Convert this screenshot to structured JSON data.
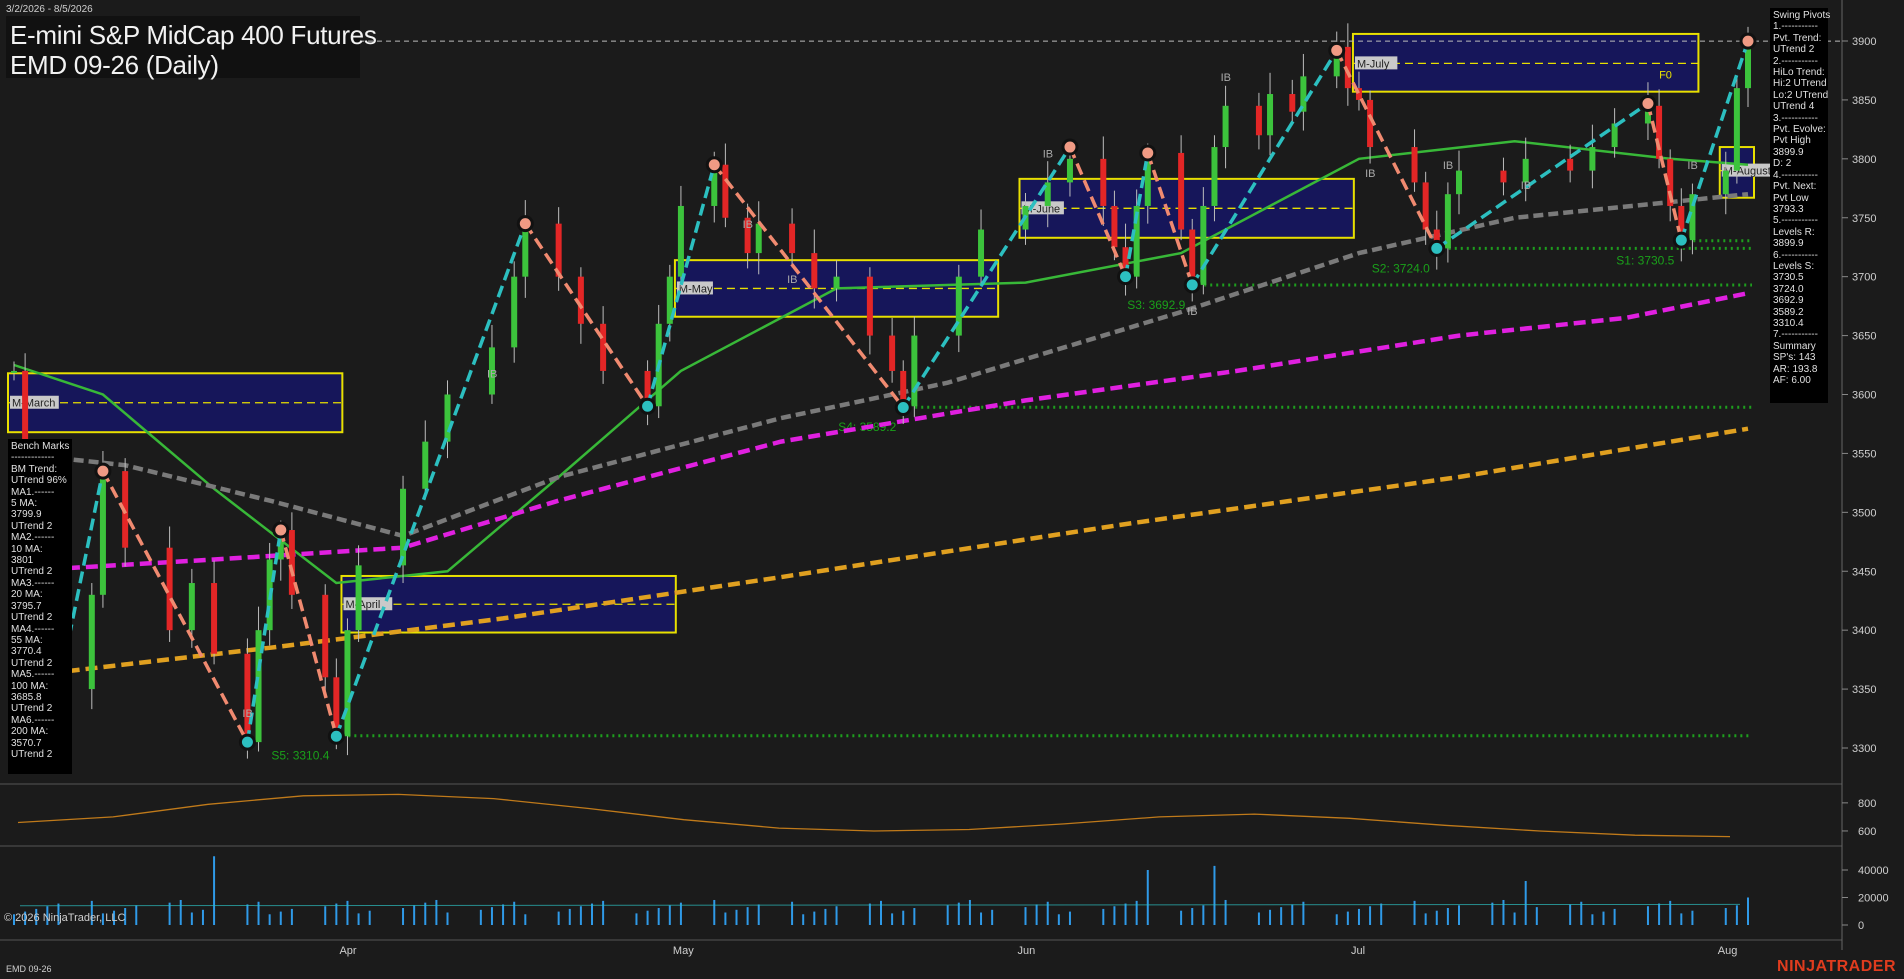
{
  "header": {
    "date_range": "3/2/2026 - 8/5/2026",
    "title": "E-mini S&P MidCap 400 Futures",
    "subtitle": "EMD 09-26 (Daily)"
  },
  "footer": {
    "copyright": "© 2026 NinjaTrader, LLC",
    "instrument": "EMD 09-26",
    "brand": "NINJATRADER"
  },
  "colors": {
    "background": "#1b1b1b",
    "up_candle": "#3cc33c",
    "down_candle": "#e32626",
    "swing_up": "#2cbfc0",
    "swing_down": "#f08a70",
    "ma_fast": "#38b838",
    "ma_slow": "#7a7a7a",
    "ma_100": "#e020e0",
    "ma_200": "#e0a020",
    "support_dotted": "#1e9e1e",
    "volume": "#2f9ae8",
    "ar_line": "#c07a1a",
    "value_box": "#16165a",
    "value_box_border": "#e8e000"
  },
  "bench_marks": {
    "lines": [
      "Bench Marks",
      "-------------",
      "BM Trend:",
      "UTrend 96%",
      "MA1.------",
      "5 MA:",
      "3799.9",
      "UTrend 2",
      "MA2.------",
      "10 MA:",
      "3801",
      "UTrend 2",
      "MA3.------",
      "20 MA:",
      "3795.7",
      "UTrend 2",
      "MA4.------",
      "55 MA:",
      "3770.4",
      "UTrend 2",
      "MA5.------",
      "100 MA:",
      "3685.8",
      "UTrend 2",
      "MA6.------",
      "200 MA:",
      "3570.7",
      "UTrend 2"
    ]
  },
  "swing_pivots": {
    "lines": [
      "Swing Pivots",
      "1.-----------",
      "Pvt. Trend:",
      "UTrend 2",
      "2.-----------",
      "HiLo Trend:",
      "Hi:2 UTrend",
      "Lo:2 UTrend",
      "UTrend 4",
      "3.-----------",
      "Pvt. Evolve:",
      "Pvt High",
      "3899.9",
      "D: 2",
      "4.-----------",
      "Pvt. Next:",
      "Pvt Low",
      "3793.3",
      "5.-----------",
      "Levels R:",
      "3899.9",
      "6.-----------",
      "Levels S:",
      "3730.5",
      "3724.0",
      "3692.9",
      "3589.2",
      "3310.4",
      "7.-----------",
      "Summary",
      "SP's: 143",
      "AR: 193.8",
      "AF: 6.00"
    ]
  },
  "chart_data": [
    {
      "type": "candlestick",
      "panel": "price",
      "x_range": [
        "2026-03-02",
        "2026-08-05"
      ],
      "ylim": [
        3270,
        3930
      ],
      "y_ticks": [
        3300,
        3350,
        3400,
        3450,
        3500,
        3550,
        3600,
        3650,
        3700,
        3750,
        3800,
        3850,
        3900
      ],
      "x_ticks": [
        {
          "label": "Apr",
          "date": "2026-04-01"
        },
        {
          "label": "May",
          "date": "2026-05-01"
        },
        {
          "label": "Jun",
          "date": "2026-06-01"
        },
        {
          "label": "Jul",
          "date": "2026-07-01"
        },
        {
          "label": "Aug",
          "date": "2026-08-03"
        }
      ],
      "close_path": [
        [
          "2026-03-02",
          3620
        ],
        [
          "2026-03-03",
          3550
        ],
        [
          "2026-03-05",
          3470
        ],
        [
          "2026-03-06",
          3350
        ],
        [
          "2026-03-09",
          3430
        ],
        [
          "2026-03-10",
          3535
        ],
        [
          "2026-03-12",
          3470
        ],
        [
          "2026-03-16",
          3400
        ],
        [
          "2026-03-18",
          3440
        ],
        [
          "2026-03-20",
          3380
        ],
        [
          "2026-03-23",
          3305
        ],
        [
          "2026-03-24",
          3400
        ],
        [
          "2026-03-25",
          3460
        ],
        [
          "2026-03-26",
          3485
        ],
        [
          "2026-03-27",
          3430
        ],
        [
          "2026-03-30",
          3360
        ],
        [
          "2026-03-31",
          3310
        ],
        [
          "2026-04-01",
          3400
        ],
        [
          "2026-04-02",
          3455
        ],
        [
          "2026-04-06",
          3520
        ],
        [
          "2026-04-08",
          3560
        ],
        [
          "2026-04-10",
          3600
        ],
        [
          "2026-04-14",
          3640
        ],
        [
          "2026-04-16",
          3700
        ],
        [
          "2026-04-17",
          3745
        ],
        [
          "2026-04-20",
          3700
        ],
        [
          "2026-04-22",
          3660
        ],
        [
          "2026-04-24",
          3620
        ],
        [
          "2026-04-28",
          3590
        ],
        [
          "2026-04-29",
          3660
        ],
        [
          "2026-04-30",
          3700
        ],
        [
          "2026-05-01",
          3760
        ],
        [
          "2026-05-04",
          3795
        ],
        [
          "2026-05-05",
          3750
        ],
        [
          "2026-05-07",
          3720
        ],
        [
          "2026-05-08",
          3745
        ],
        [
          "2026-05-11",
          3720
        ],
        [
          "2026-05-13",
          3690
        ],
        [
          "2026-05-15",
          3700
        ],
        [
          "2026-05-18",
          3650
        ],
        [
          "2026-05-20",
          3620
        ],
        [
          "2026-05-21",
          3590
        ],
        [
          "2026-05-22",
          3650
        ],
        [
          "2026-05-26",
          3700
        ],
        [
          "2026-05-28",
          3740
        ],
        [
          "2026-06-01",
          3760
        ],
        [
          "2026-06-03",
          3780
        ],
        [
          "2026-06-05",
          3800
        ],
        [
          "2026-06-08",
          3760
        ],
        [
          "2026-06-09",
          3725
        ],
        [
          "2026-06-10",
          3700
        ],
        [
          "2026-06-11",
          3760
        ],
        [
          "2026-06-12",
          3805
        ],
        [
          "2026-06-15",
          3740
        ],
        [
          "2026-06-16",
          3693
        ],
        [
          "2026-06-17",
          3760
        ],
        [
          "2026-06-18",
          3810
        ],
        [
          "2026-06-19",
          3845
        ],
        [
          "2026-06-22",
          3820
        ],
        [
          "2026-06-23",
          3855
        ],
        [
          "2026-06-25",
          3840
        ],
        [
          "2026-06-26",
          3870
        ],
        [
          "2026-06-29",
          3895
        ],
        [
          "2026-06-30",
          3860
        ],
        [
          "2026-07-01",
          3850
        ],
        [
          "2026-07-02",
          3810
        ],
        [
          "2026-07-06",
          3780
        ],
        [
          "2026-07-07",
          3740
        ],
        [
          "2026-07-08",
          3724
        ],
        [
          "2026-07-09",
          3770
        ],
        [
          "2026-07-10",
          3790
        ],
        [
          "2026-07-14",
          3780
        ],
        [
          "2026-07-16",
          3800
        ],
        [
          "2026-07-20",
          3790
        ],
        [
          "2026-07-22",
          3810
        ],
        [
          "2026-07-24",
          3830
        ],
        [
          "2026-07-27",
          3845
        ],
        [
          "2026-07-28",
          3800
        ],
        [
          "2026-07-29",
          3760
        ],
        [
          "2026-07-30",
          3731
        ],
        [
          "2026-07-31",
          3770
        ],
        [
          "2026-08-03",
          3790
        ],
        [
          "2026-08-04",
          3860
        ],
        [
          "2026-08-05",
          3895
        ]
      ],
      "moving_averages": [
        {
          "name": "20 MA",
          "color": "#38b838",
          "points": [
            [
              "2026-03-02",
              3625
            ],
            [
              "2026-03-10",
              3600
            ],
            [
              "2026-03-20",
              3520
            ],
            [
              "2026-03-31",
              3440
            ],
            [
              "2026-04-10",
              3450
            ],
            [
              "2026-04-20",
              3530
            ],
            [
              "2026-05-01",
              3620
            ],
            [
              "2026-05-15",
              3690
            ],
            [
              "2026-06-01",
              3695
            ],
            [
              "2026-06-15",
              3720
            ],
            [
              "2026-07-01",
              3800
            ],
            [
              "2026-07-15",
              3815
            ],
            [
              "2026-07-29",
              3800
            ],
            [
              "2026-08-05",
              3795
            ]
          ]
        },
        {
          "name": "55 MA",
          "color": "#7a7a7a",
          "points": [
            [
              "2026-03-02",
              3550
            ],
            [
              "2026-03-12",
              3540
            ],
            [
              "2026-03-25",
              3510
            ],
            [
              "2026-04-06",
              3480
            ],
            [
              "2026-04-20",
              3530
            ],
            [
              "2026-05-10",
              3580
            ],
            [
              "2026-05-25",
              3610
            ],
            [
              "2026-06-15",
              3670
            ],
            [
              "2026-07-01",
              3720
            ],
            [
              "2026-07-15",
              3750
            ],
            [
              "2026-08-05",
              3770
            ]
          ]
        },
        {
          "name": "100 MA",
          "color": "#e020e0",
          "points": [
            [
              "2026-03-02",
              3450
            ],
            [
              "2026-03-20",
              3460
            ],
            [
              "2026-04-06",
              3470
            ],
            [
              "2026-04-20",
              3510
            ],
            [
              "2026-05-10",
              3560
            ],
            [
              "2026-06-01",
              3595
            ],
            [
              "2026-06-20",
              3620
            ],
            [
              "2026-07-10",
              3650
            ],
            [
              "2026-07-25",
              3665
            ],
            [
              "2026-08-05",
              3686
            ]
          ]
        },
        {
          "name": "200 MA",
          "color": "#e0a020",
          "points": [
            [
              "2026-03-02",
              3360
            ],
            [
              "2026-03-25",
              3385
            ],
            [
              "2026-04-15",
              3410
            ],
            [
              "2026-05-10",
              3445
            ],
            [
              "2026-06-10",
              3490
            ],
            [
              "2026-07-10",
              3530
            ],
            [
              "2026-08-05",
              3571
            ]
          ]
        }
      ],
      "swing_points": [
        {
          "date": "2026-03-06",
          "price": 3350,
          "kind": "low"
        },
        {
          "date": "2026-03-10",
          "price": 3535,
          "kind": "high"
        },
        {
          "date": "2026-03-23",
          "price": 3305,
          "kind": "low"
        },
        {
          "date": "2026-03-26",
          "price": 3485,
          "kind": "high"
        },
        {
          "date": "2026-03-31",
          "price": 3310,
          "kind": "low"
        },
        {
          "date": "2026-04-17",
          "price": 3745,
          "kind": "high"
        },
        {
          "date": "2026-04-28",
          "price": 3590,
          "kind": "low"
        },
        {
          "date": "2026-05-04",
          "price": 3795,
          "kind": "high"
        },
        {
          "date": "2026-05-21",
          "price": 3589,
          "kind": "low"
        },
        {
          "date": "2026-06-05",
          "price": 3810,
          "kind": "high"
        },
        {
          "date": "2026-06-10",
          "price": 3700,
          "kind": "low"
        },
        {
          "date": "2026-06-12",
          "price": 3805,
          "kind": "high"
        },
        {
          "date": "2026-06-16",
          "price": 3693,
          "kind": "low"
        },
        {
          "date": "2026-06-29",
          "price": 3892,
          "kind": "high"
        },
        {
          "date": "2026-07-08",
          "price": 3724,
          "kind": "low"
        },
        {
          "date": "2026-07-27",
          "price": 3847,
          "kind": "high"
        },
        {
          "date": "2026-07-30",
          "price": 3731,
          "kind": "low"
        },
        {
          "date": "2026-08-05",
          "price": 3899.9,
          "kind": "high"
        }
      ],
      "support_levels": [
        {
          "label": "S5: 3310.4",
          "value": 3310.4,
          "from": "2026-03-31"
        },
        {
          "label": "S4: 3589.2",
          "value": 3589.2,
          "from": "2026-05-21"
        },
        {
          "label": "S3: 3692.9",
          "value": 3692.9,
          "from": "2026-06-16"
        },
        {
          "label": "S2: 3724.0",
          "value": 3724.0,
          "from": "2026-07-08"
        },
        {
          "label": "S1: 3730.5",
          "value": 3730.5,
          "from": "2026-07-30"
        }
      ],
      "value_areas": [
        {
          "label": "M-March",
          "start": "2026-03-02",
          "end": "2026-03-31",
          "high": 3618,
          "low": 3568,
          "mid": 3593
        },
        {
          "label": "M-April",
          "start": "2026-04-01",
          "end": "2026-04-30",
          "high": 3446,
          "low": 3398,
          "mid": 3422
        },
        {
          "label": "M-May",
          "start": "2026-05-01",
          "end": "2026-05-29",
          "high": 3714,
          "low": 3666,
          "mid": 3690
        },
        {
          "label": "M-June",
          "start": "2026-06-01",
          "end": "2026-06-30",
          "high": 3783,
          "low": 3733,
          "mid": 3758
        },
        {
          "label": "M-July",
          "start": "2026-07-01",
          "end": "2026-07-31",
          "high": 3906,
          "low": 3857,
          "mid": 3881
        },
        {
          "label": "M-August",
          "start": "2026-08-03",
          "end": "2026-08-05",
          "high": 3810,
          "low": 3767,
          "mid": 3790
        }
      ],
      "markers": [
        "IB",
        "F0"
      ]
    },
    {
      "type": "line",
      "panel": "range",
      "series": [
        {
          "color": "#c07a1a",
          "values": [
            660,
            700,
            790,
            850,
            860,
            830,
            760,
            680,
            620,
            600,
            610,
            650,
            700,
            720,
            690,
            640,
            600,
            570,
            560
          ]
        }
      ],
      "y_ticks": [
        600,
        800
      ],
      "ylim": [
        500,
        920
      ]
    },
    {
      "type": "bar",
      "panel": "volume",
      "y_ticks": [
        0,
        20000,
        40000
      ],
      "ylim": [
        0,
        52000
      ],
      "spikes": [
        {
          "date": "2026-03-20",
          "value": 50000
        },
        {
          "date": "2026-06-12",
          "value": 40000
        },
        {
          "date": "2026-06-18",
          "value": 43000
        },
        {
          "date": "2026-07-16",
          "value": 32000
        },
        {
          "date": "2026-08-05",
          "value": 20000
        }
      ],
      "typical": 13000
    }
  ]
}
